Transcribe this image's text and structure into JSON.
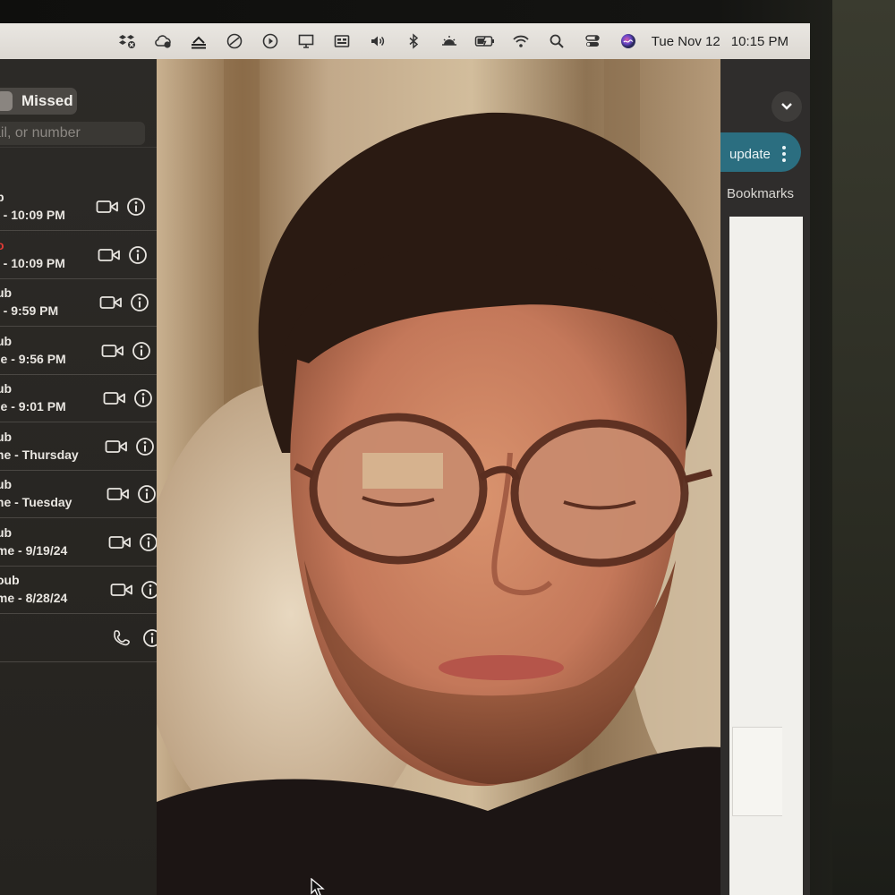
{
  "menubar": {
    "date": "Tue Nov 12",
    "time": "10:15 PM",
    "icons": [
      "dropbox-icon",
      "cloud-sync-icon",
      "menu-app-icon",
      "do-not-disturb-icon",
      "play-circle-icon",
      "display-icon",
      "screen-share-icon",
      "volume-icon",
      "bluetooth-icon",
      "brightness-icon",
      "battery-charging-icon",
      "wifi-icon",
      "search-icon",
      "control-center-icon",
      "siri-icon"
    ]
  },
  "sidebar": {
    "segment_label": "Missed",
    "search_placeholder": "ail, or number",
    "calls": [
      {
        "name": "b",
        "detail": "e - 10:09 PM",
        "icon": "video-icon",
        "missed": false
      },
      {
        "name": "o",
        "detail": "e - 10:09 PM",
        "icon": "video-icon",
        "missed": true
      },
      {
        "name": "ub",
        "detail": "e - 9:59 PM",
        "icon": "video-icon",
        "missed": false
      },
      {
        "name": "ub",
        "detail": "ne - 9:56 PM",
        "icon": "video-icon",
        "missed": false
      },
      {
        "name": "ub",
        "detail": "ne - 9:01 PM",
        "icon": "video-icon",
        "missed": false
      },
      {
        "name": "ub",
        "detail": "me - Thursday",
        "icon": "video-icon",
        "missed": false
      },
      {
        "name": "ub",
        "detail": "me - Tuesday",
        "icon": "video-icon",
        "missed": false
      },
      {
        "name": "ub",
        "detail": "ime - 9/19/24",
        "icon": "video-icon",
        "missed": false
      },
      {
        "name": "oub",
        "detail": "ime - 8/28/24",
        "icon": "video-icon",
        "missed": false
      },
      {
        "name": "",
        "detail": "",
        "icon": "phone-icon",
        "missed": false
      }
    ]
  },
  "browser": {
    "update_label": "update",
    "bookmarks_label": "Bookmarks"
  }
}
